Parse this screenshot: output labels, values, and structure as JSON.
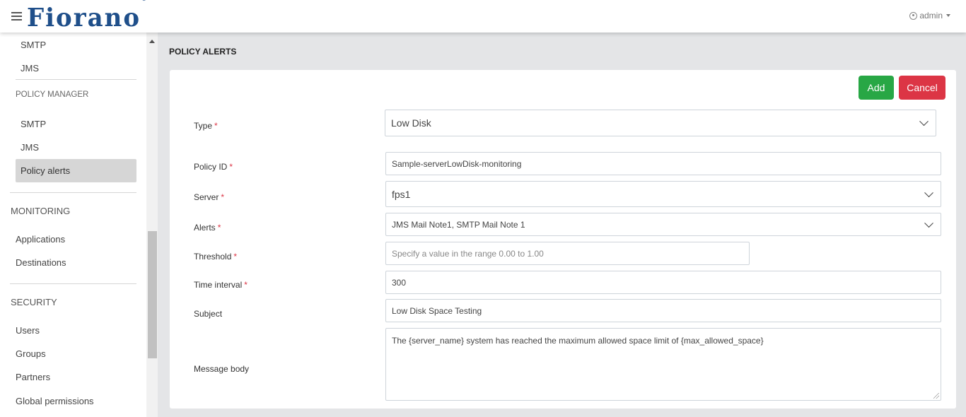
{
  "header": {
    "logo_text": "Fiorano",
    "logo_mark": "®",
    "user_label": "admin"
  },
  "sidebar": {
    "items_top": [
      {
        "label": "SMTP"
      },
      {
        "label": "JMS"
      }
    ],
    "policy_manager": {
      "heading": "POLICY MANAGER",
      "items": [
        {
          "label": "SMTP"
        },
        {
          "label": "JMS"
        },
        {
          "label": "Policy alerts",
          "active": true
        }
      ]
    },
    "monitoring": {
      "heading": "MONITORING",
      "items": [
        {
          "label": "Applications"
        },
        {
          "label": "Destinations"
        }
      ]
    },
    "security": {
      "heading": "SECURITY",
      "items": [
        {
          "label": "Users"
        },
        {
          "label": "Groups"
        },
        {
          "label": "Partners"
        },
        {
          "label": "Global permissions"
        }
      ]
    }
  },
  "main": {
    "title": "POLICY ALERTS",
    "buttons": {
      "add": "Add",
      "cancel": "Cancel"
    },
    "required_marker": "*",
    "form": {
      "type": {
        "label": "Type",
        "value": "Low Disk"
      },
      "policy_id": {
        "label": "Policy ID",
        "value": "Sample-serverLowDisk-monitoring"
      },
      "server": {
        "label": "Server",
        "value": "fps1"
      },
      "alerts": {
        "label": "Alerts",
        "value": "JMS Mail Note1, SMTP Mail Note 1"
      },
      "threshold": {
        "label": "Threshold",
        "placeholder": "Specify a value in the range 0.00 to 1.00"
      },
      "time_interval": {
        "label": "Time interval",
        "value": "300"
      },
      "subject": {
        "label": "Subject",
        "value": "Low Disk Space Testing"
      },
      "message_body": {
        "label": "Message body",
        "value": "The {server_name} system has reached the maximum allowed space limit of {max_allowed_space}"
      }
    }
  },
  "colors": {
    "brand": "#1f4f8a",
    "add_button": "#28a745",
    "cancel_button": "#dc3545",
    "required": "#dc3545",
    "active_nav": "#d6d6d6"
  }
}
